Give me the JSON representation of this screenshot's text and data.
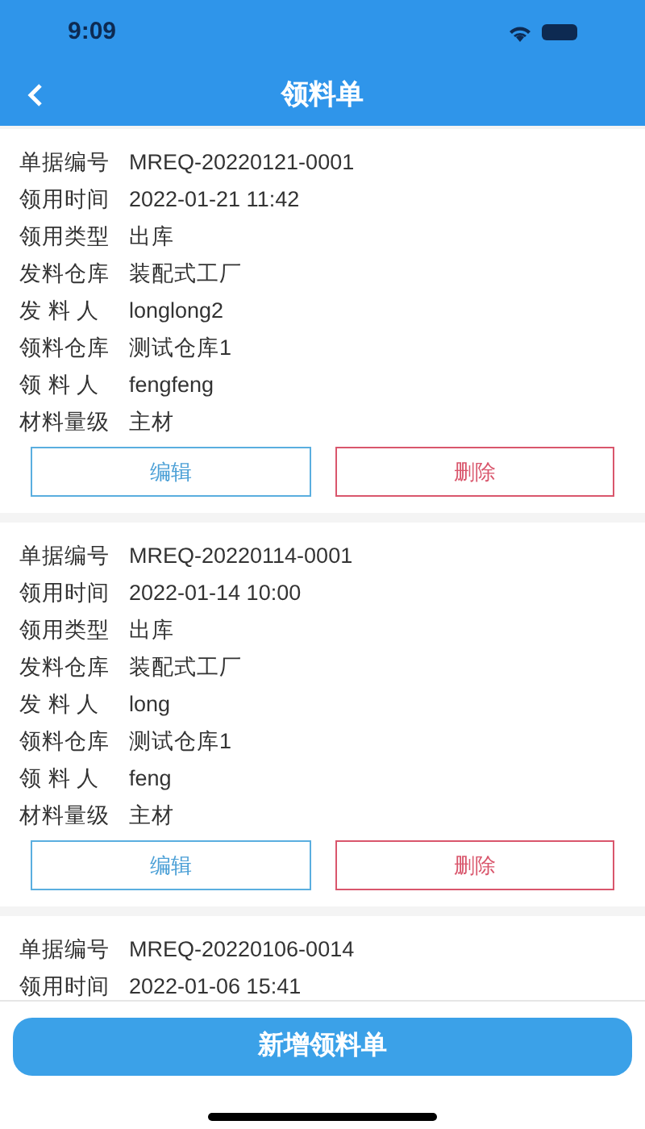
{
  "status_bar": {
    "time": "9:09"
  },
  "nav": {
    "title": "领料单"
  },
  "records": [
    {
      "fields": [
        {
          "label": "单据编号",
          "value": "MREQ-20220121-0001"
        },
        {
          "label": "领用时间",
          "value": "2022-01-21 11:42"
        },
        {
          "label": "领用类型",
          "value": "出库"
        },
        {
          "label": "发料仓库",
          "value": "装配式工厂"
        },
        {
          "label": "发 料 人",
          "value": "longlong2"
        },
        {
          "label": "领料仓库",
          "value": "测试仓库1"
        },
        {
          "label": "领 料 人",
          "value": "fengfeng"
        },
        {
          "label": "材料量级",
          "value": "主材"
        }
      ],
      "buttons": [
        {
          "kind": "edit",
          "label": "编辑"
        },
        {
          "kind": "delete",
          "label": "删除"
        }
      ]
    },
    {
      "fields": [
        {
          "label": "单据编号",
          "value": "MREQ-20220114-0001"
        },
        {
          "label": "领用时间",
          "value": "2022-01-14 10:00"
        },
        {
          "label": "领用类型",
          "value": "出库"
        },
        {
          "label": "发料仓库",
          "value": "装配式工厂"
        },
        {
          "label": "发 料 人",
          "value": "long"
        },
        {
          "label": "领料仓库",
          "value": "测试仓库1"
        },
        {
          "label": "领 料 人",
          "value": "feng"
        },
        {
          "label": "材料量级",
          "value": "主材"
        }
      ],
      "buttons": [
        {
          "kind": "edit",
          "label": "编辑"
        },
        {
          "kind": "delete",
          "label": "删除"
        }
      ]
    },
    {
      "fields": [
        {
          "label": "单据编号",
          "value": "MREQ-20220106-0014"
        },
        {
          "label": "领用时间",
          "value": "2022-01-06 15:41"
        }
      ]
    }
  ],
  "add_button": {
    "label": "新增领料单"
  }
}
